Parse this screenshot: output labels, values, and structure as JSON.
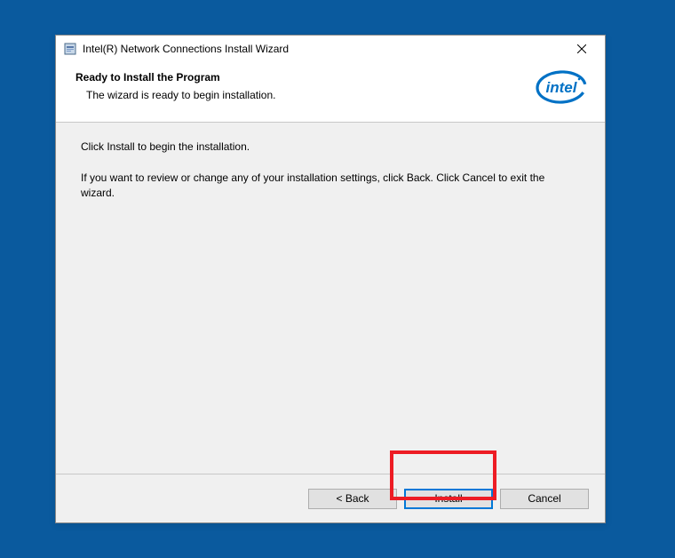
{
  "titlebar": {
    "title": "Intel(R) Network Connections Install Wizard"
  },
  "header": {
    "title": "Ready to Install the Program",
    "subtitle": "The wizard is ready to begin installation."
  },
  "body": {
    "line1": "Click Install to begin the installation.",
    "line2": "If you want to review or change any of your installation settings, click Back. Click Cancel to exit the wizard."
  },
  "buttons": {
    "back": "< Back",
    "install": "Install",
    "cancel": "Cancel"
  },
  "brand": {
    "name": "intel"
  }
}
